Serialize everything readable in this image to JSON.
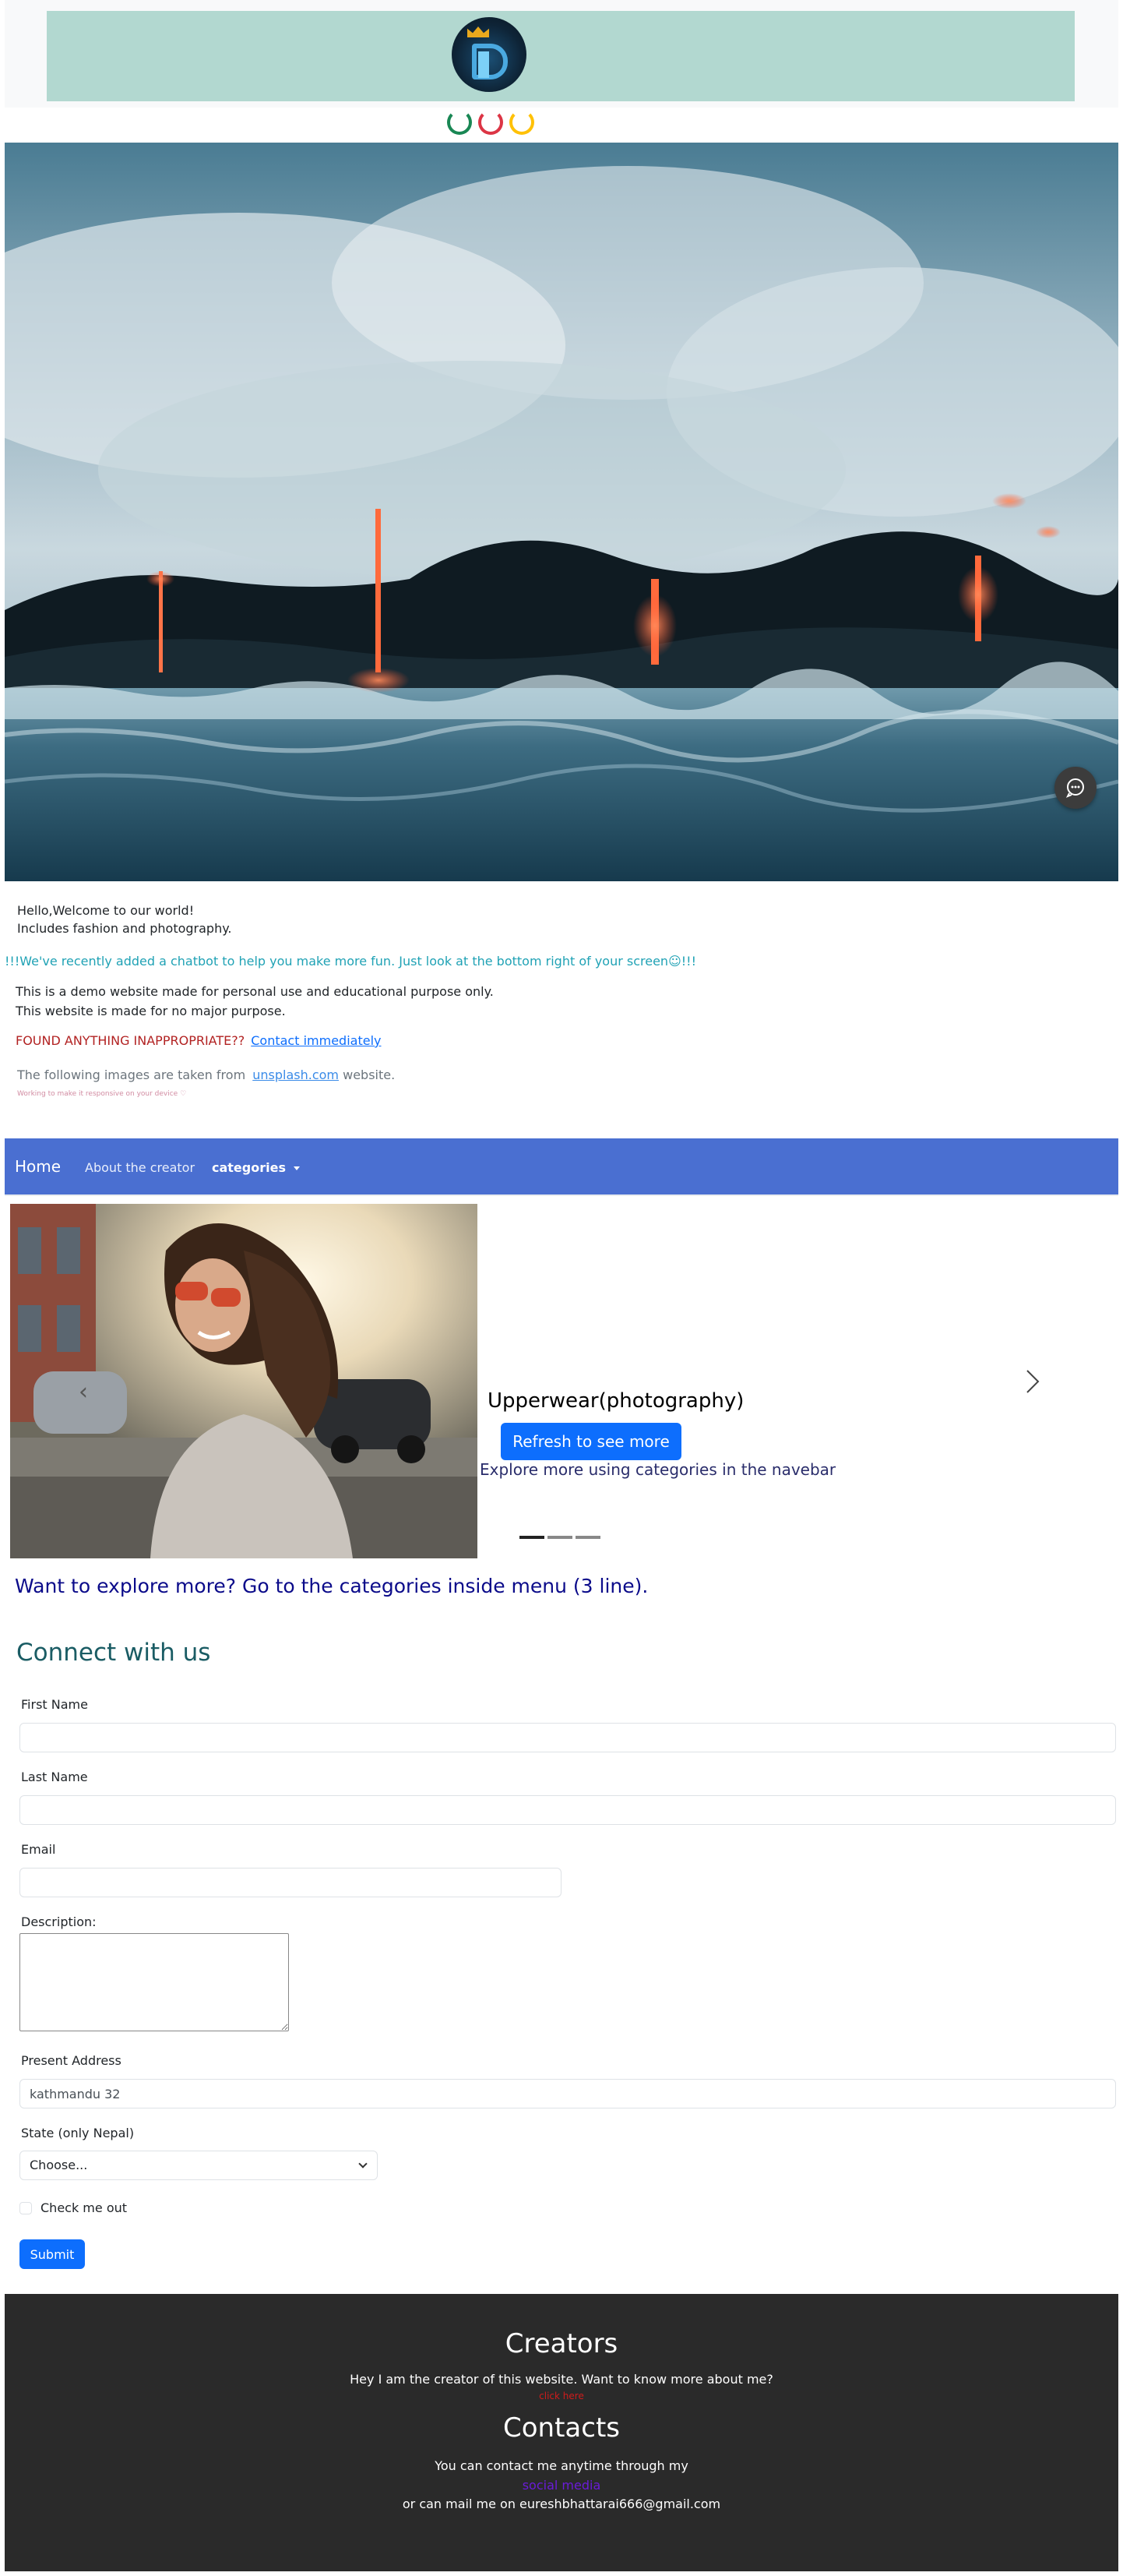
{
  "header": {
    "logo_icon": "logo-icon",
    "loading_spinners": [
      "green",
      "red",
      "yellow"
    ]
  },
  "hero": {
    "image_icon": "lava-ocean-photo",
    "chat_icon": "chat-bubble-icon"
  },
  "intro": {
    "line1": "Hello,Welcome to our world!",
    "line2": "Includes fashion and photography.",
    "chatbot_note": "!!!We've recently added a chatbot to help you make more fun. Just look at the bottom right of your screen☺!!!",
    "demo_line1": "This is a demo website made for personal use and educational purpose only.",
    "demo_line2": "This website is made for no major purpose.",
    "report_warning": "FOUND ANYTHING INAPPROPRIATE??",
    "report_link": "Contact immediately",
    "source_prefix": "The following images are taken from",
    "source_link": "unsplash.com",
    "source_suffix": "website.",
    "tiny_note": "Working to make it responsive on your device ♡"
  },
  "navbar": {
    "brand": "Home",
    "about": "About the creator",
    "categories": "categories"
  },
  "carousel": {
    "caption_title": "Upperwear(photography)",
    "caption_button": "Refresh to see more",
    "caption_sub": "Explore more using categories in the navebar",
    "prev_icon": "chevron-left-icon",
    "next_icon": "chevron-right-icon",
    "slides": 3,
    "active_slide": 1
  },
  "explore_more": "Want to explore more? Go to the categories inside menu (3 line).",
  "connect": {
    "title": "Connect with us",
    "first_name_label": "First Name",
    "last_name_label": "Last Name",
    "email_label": "Email",
    "description_label": "Description:",
    "address_label": "Present Address",
    "address_value": "kathmandu 32",
    "state_label": "State (only Nepal)",
    "state_value": "Choose...",
    "check_label": "Check me out",
    "submit_label": "Submit"
  },
  "footer": {
    "creators_title": "Creators",
    "creators_text": "Hey I am the creator of this website. Want to know more about me?",
    "creators_link": "click here",
    "contacts_title": "Contacts",
    "contacts_text": "You can contact me anytime through my",
    "social_link": "social media",
    "mail_text": "or can mail me on eureshbhattarai666@gmail.com"
  }
}
